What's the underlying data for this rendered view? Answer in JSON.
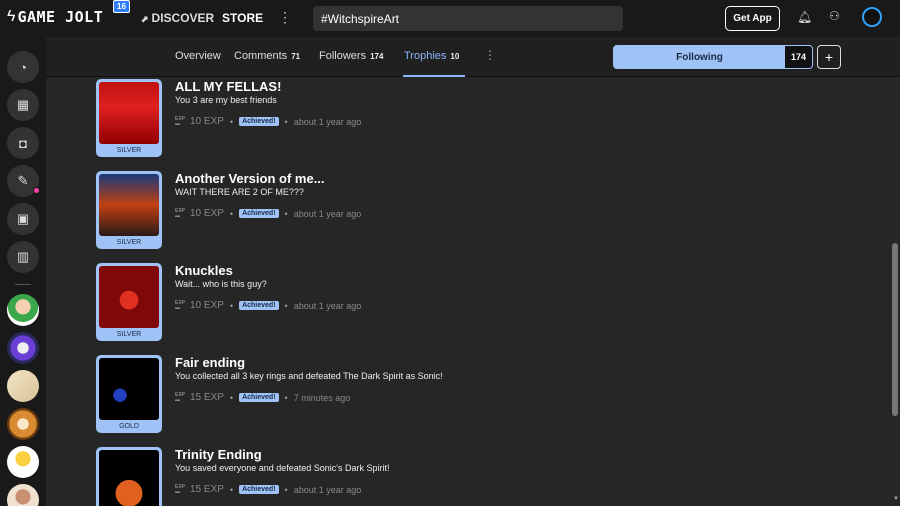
{
  "topbar": {
    "logo_text": "GAME JOLT",
    "logo_badge": "16",
    "discover": "DISCOVER",
    "store": "STORE",
    "search_value": "#WitchspireArt",
    "get_app": "Get App"
  },
  "subnav": {
    "tabs": [
      {
        "label": "Overview",
        "count": ""
      },
      {
        "label": "Comments",
        "count": "71"
      },
      {
        "label": "Followers",
        "count": "174"
      },
      {
        "label": "Trophies",
        "count": "10"
      }
    ],
    "follow_label": "Following",
    "follow_count": "174",
    "plus": "+"
  },
  "colors": {
    "accent": "#9fc3f7",
    "active_tab": "#8ab4f8",
    "notification_dot": "#ff3fac"
  },
  "trophies": [
    {
      "title": "ALL MY FELLAS!",
      "description": "You 3 are my best friends",
      "exp": "10 EXP",
      "status": "Achieved!",
      "time": "about 1 year ago",
      "tier": "SILVER"
    },
    {
      "title": "Another Version of me...",
      "description": "WAIT THERE ARE 2 OF ME???",
      "exp": "10 EXP",
      "status": "Achieved!",
      "time": "about 1 year ago",
      "tier": "SILVER"
    },
    {
      "title": "Knuckles",
      "description": "Wait... who is this guy?",
      "exp": "10 EXP",
      "status": "Achieved!",
      "time": "about 1 year ago",
      "tier": "SILVER"
    },
    {
      "title": "Fair ending",
      "description": "You collected all 3 key rings and defeated The Dark Spirit as Sonic!",
      "exp": "15 EXP",
      "status": "Achieved!",
      "time": "7 minutes ago",
      "tier": "GOLD"
    },
    {
      "title": "Trinity Ending",
      "description": "You saved everyone and defeated Sonic's Dark Spirit!",
      "exp": "15 EXP",
      "status": "Achieved!",
      "time": "about 1 year ago",
      "tier": ""
    }
  ]
}
